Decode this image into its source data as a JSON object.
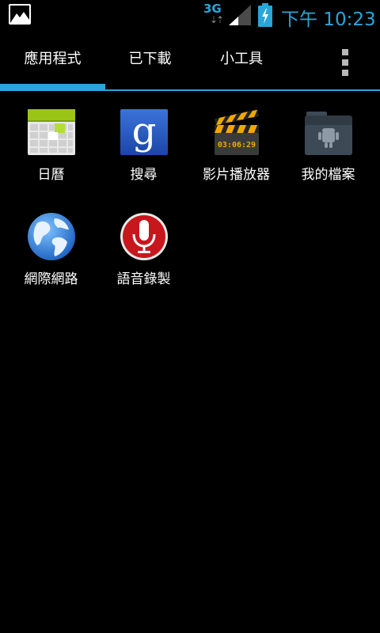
{
  "status_bar": {
    "network_type": "3G",
    "time": "下午 10:23",
    "colors": {
      "accent": "#2aa6d9"
    }
  },
  "tabs": [
    {
      "label": "應用程式",
      "selected": true
    },
    {
      "label": "已下載",
      "selected": false
    },
    {
      "label": "小工具",
      "selected": false
    }
  ],
  "apps": [
    {
      "label": "日曆",
      "icon": "calendar-icon"
    },
    {
      "label": "搜尋",
      "icon": "google-search-icon"
    },
    {
      "label": "影片播放器",
      "icon": "video-player-icon",
      "icon_text": "03:06:29"
    },
    {
      "label": "我的檔案",
      "icon": "my-files-folder-icon"
    },
    {
      "label": "網際網路",
      "icon": "globe-icon"
    },
    {
      "label": "語音錄製",
      "icon": "microphone-icon"
    }
  ]
}
